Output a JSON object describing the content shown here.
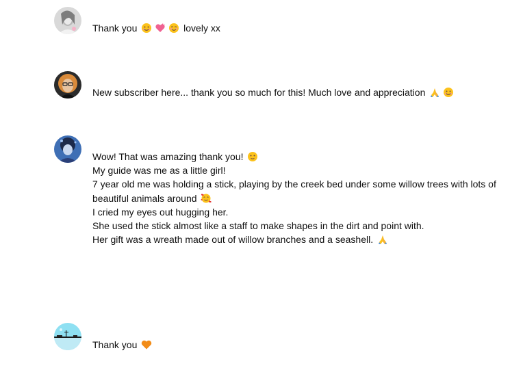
{
  "comments": [
    {
      "avatar_icon": "user-avatar-icon",
      "lines": [
        {
          "text": "Thank you ",
          "emojis": [
            "smile-emoji-icon",
            "pink-heart-emoji-icon",
            "blush-emoji-icon"
          ],
          "after": " lovely xx"
        }
      ]
    },
    {
      "avatar_icon": "user-avatar-icon",
      "lines": [
        {
          "text": "New subscriber here... thank you so much for this! Much love and appreciation ",
          "emojis": [
            "praying-hands-emoji-icon",
            "smile-emoji-icon"
          ],
          "after": ""
        }
      ]
    },
    {
      "avatar_icon": "user-avatar-icon",
      "lines": [
        {
          "text": "Wow! That was amazing thank you! ",
          "emojis": [
            "slight-smile-emoji-icon"
          ],
          "after": ""
        },
        {
          "text": "My guide was me as a little girl!",
          "emojis": [],
          "after": ""
        },
        {
          "text": "7 year old me was holding a stick, playing by the creek bed under some willow trees with lots of",
          "emojis": [],
          "after": ""
        },
        {
          "text": "beautiful animals around ",
          "emojis": [
            "hearts-face-emoji-icon"
          ],
          "after": ""
        },
        {
          "text": "I cried my eyes out hugging her.",
          "emojis": [],
          "after": ""
        },
        {
          "text": "She used the stick almost like a staff to make shapes in the dirt and point with.",
          "emojis": [],
          "after": ""
        },
        {
          "text": "Her gift was a wreath made out of willow branches and a seashell. ",
          "emojis": [
            "praying-hands-emoji-icon"
          ],
          "after": ""
        }
      ]
    },
    {
      "avatar_icon": "user-avatar-icon",
      "lines": [
        {
          "text": "Thank you ",
          "emojis": [
            "orange-heart-emoji-icon"
          ],
          "after": ""
        }
      ]
    }
  ]
}
